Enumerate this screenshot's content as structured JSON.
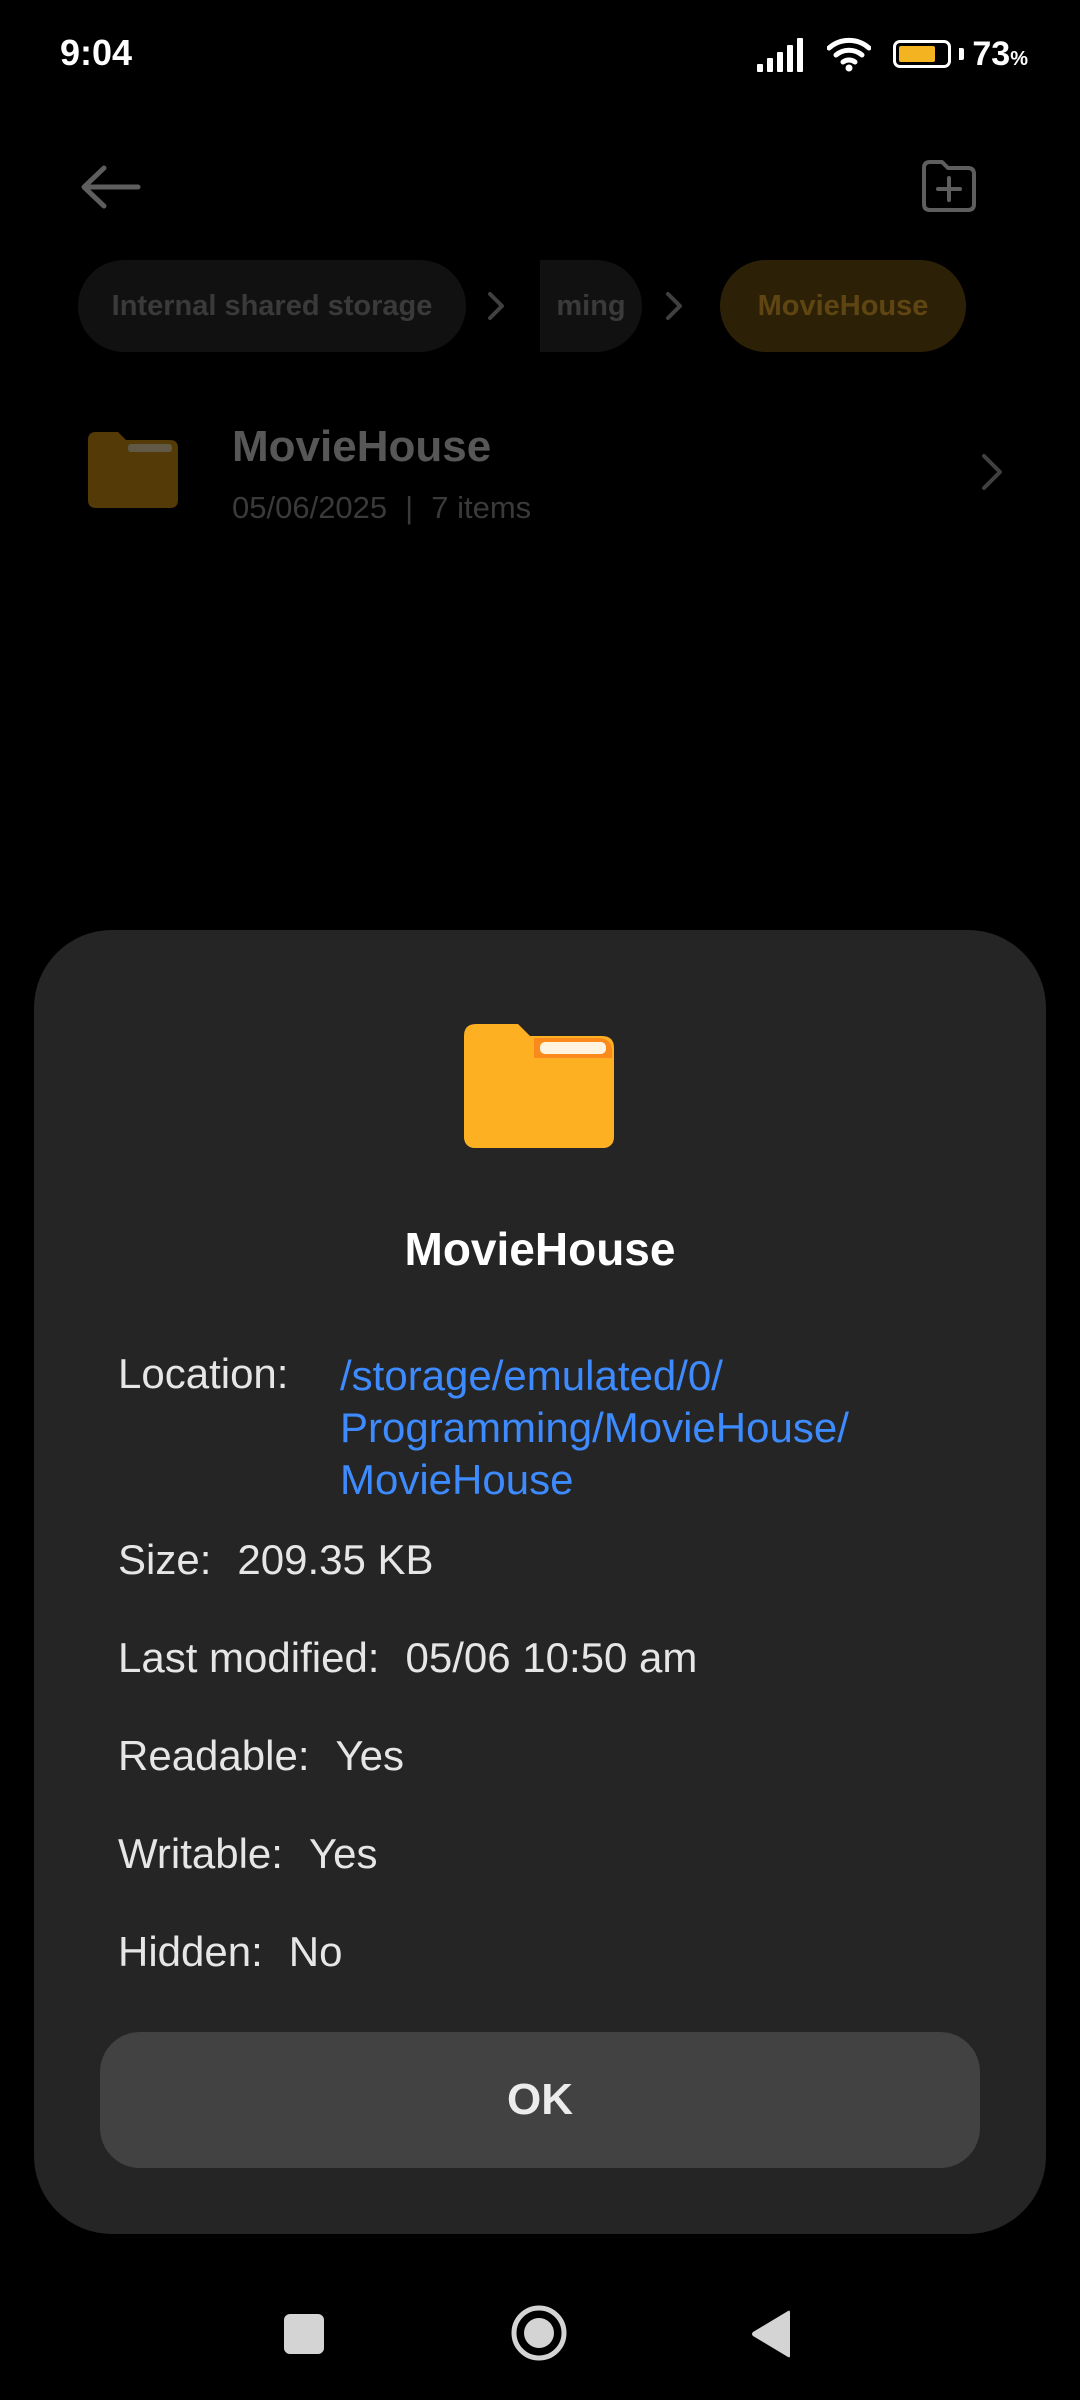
{
  "status_bar": {
    "time": "9:04",
    "battery_level": "73",
    "battery_unit": "%",
    "icons": [
      "signal-icon",
      "wifi-icon",
      "battery-icon"
    ]
  },
  "toolbar": {
    "back_icon": "back-arrow-icon",
    "new_folder_icon": "new-folder-icon"
  },
  "breadcrumb": {
    "items": [
      "Internal shared storage",
      "ming",
      "MovieHouse"
    ],
    "current_index": 2
  },
  "file_list": {
    "items": [
      {
        "name": "MovieHouse",
        "date": "05/06/2025",
        "separator": "|",
        "count": "7 items"
      }
    ]
  },
  "dialog": {
    "title": "MovieHouse",
    "location_label": "Location:",
    "location_value": "/storage/emulated/0/\nProgramming/MovieHouse/\nMovieHouse",
    "size_label": "Size:",
    "size_value": "209.35 KB",
    "modified_label": "Last modified:",
    "modified_value": "05/06 10:50 am",
    "readable_label": "Readable:",
    "readable_value": "Yes",
    "writable_label": "Writable:",
    "writable_value": "Yes",
    "hidden_label": "Hidden:",
    "hidden_value": "No",
    "ok_label": "OK"
  },
  "colors": {
    "accent_folder": "#FDB022",
    "link": "#3D8BFF",
    "dialog_bg": "#252525",
    "button_bg": "#424242"
  },
  "nav_bar": {
    "buttons": [
      "recents-icon",
      "home-icon",
      "back-icon"
    ]
  }
}
